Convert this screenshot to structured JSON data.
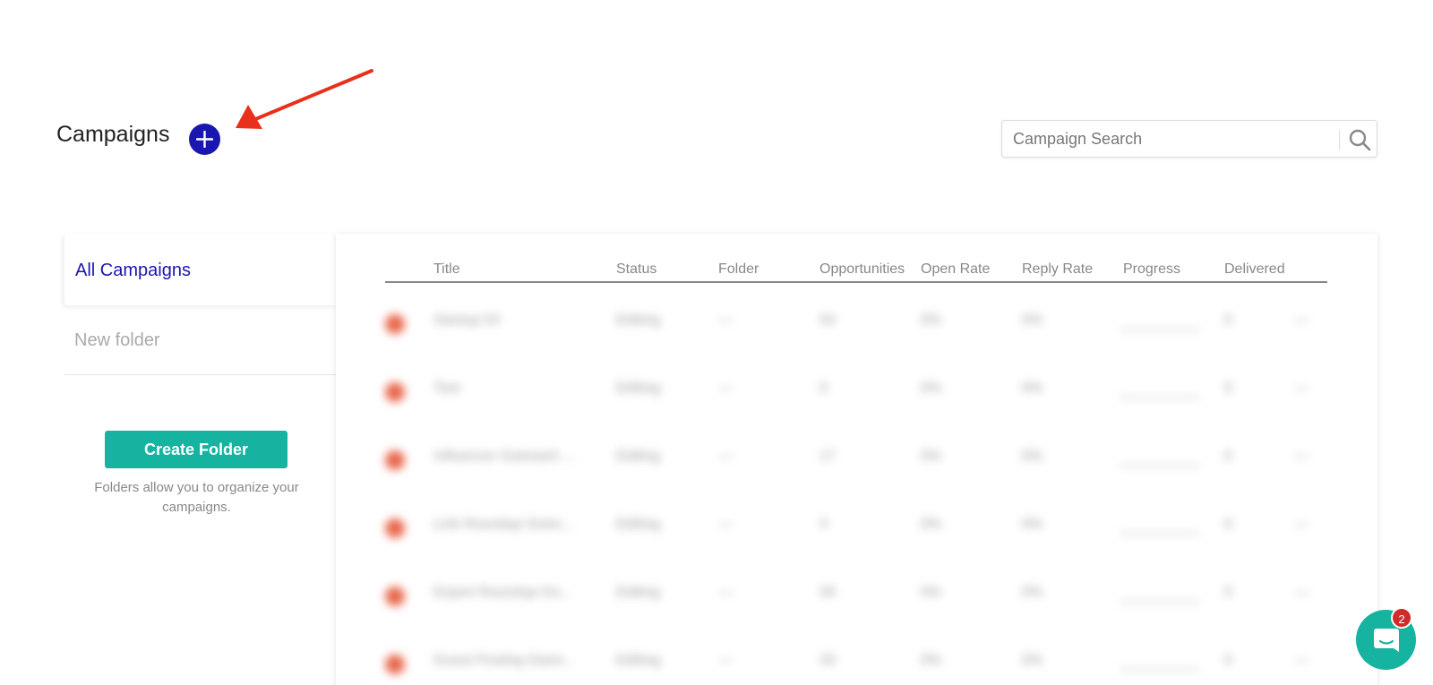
{
  "header": {
    "title": "Campaigns",
    "add_icon": "plus-icon"
  },
  "search": {
    "placeholder": "Campaign Search",
    "value": "",
    "icon": "search-icon"
  },
  "sidebar": {
    "items": [
      {
        "label": "All Campaigns",
        "active": true
      },
      {
        "label": "New folder",
        "active": false
      }
    ],
    "create_folder_label": "Create Folder",
    "note": "Folders allow you to organize your campaigns."
  },
  "table": {
    "columns": [
      "Title",
      "Status",
      "Folder",
      "Opportunities",
      "Open Rate",
      "Reply Rate",
      "Progress",
      "Delivered"
    ],
    "rows": [
      {
        "title": "Startup 03",
        "status": "Editing",
        "folder": "—",
        "opportunities": "54",
        "open_rate": "0%",
        "reply_rate": "0%",
        "progress": "",
        "delivered": "0",
        "extra": "—"
      },
      {
        "title": "Test",
        "status": "Editing",
        "folder": "—",
        "opportunities": "0",
        "open_rate": "0%",
        "reply_rate": "0%",
        "progress": "",
        "delivered": "0",
        "extra": "—"
      },
      {
        "title": "Influencer Outreach ...",
        "status": "Editing",
        "folder": "—",
        "opportunities": "17",
        "open_rate": "0%",
        "reply_rate": "0%",
        "progress": "",
        "delivered": "0",
        "extra": "—"
      },
      {
        "title": "Link Roundup Outre...",
        "status": "Editing",
        "folder": "—",
        "opportunities": "3",
        "open_rate": "0%",
        "reply_rate": "0%",
        "progress": "",
        "delivered": "0",
        "extra": "—"
      },
      {
        "title": "Expert Roundup Ou...",
        "status": "Editing",
        "folder": "—",
        "opportunities": "26",
        "open_rate": "0%",
        "reply_rate": "0%",
        "progress": "",
        "delivered": "0",
        "extra": "—"
      },
      {
        "title": "Guest Posting Outre...",
        "status": "Editing",
        "folder": "—",
        "opportunities": "33",
        "open_rate": "0%",
        "reply_rate": "0%",
        "progress": "",
        "delivered": "0",
        "extra": "—"
      }
    ]
  },
  "chat": {
    "icon": "chat-bubble-icon",
    "badge": "2"
  },
  "colors": {
    "accent": "#1a16b0",
    "teal": "#15b3a0",
    "annotation_arrow": "#e8301c",
    "badge": "#d22a2a"
  }
}
